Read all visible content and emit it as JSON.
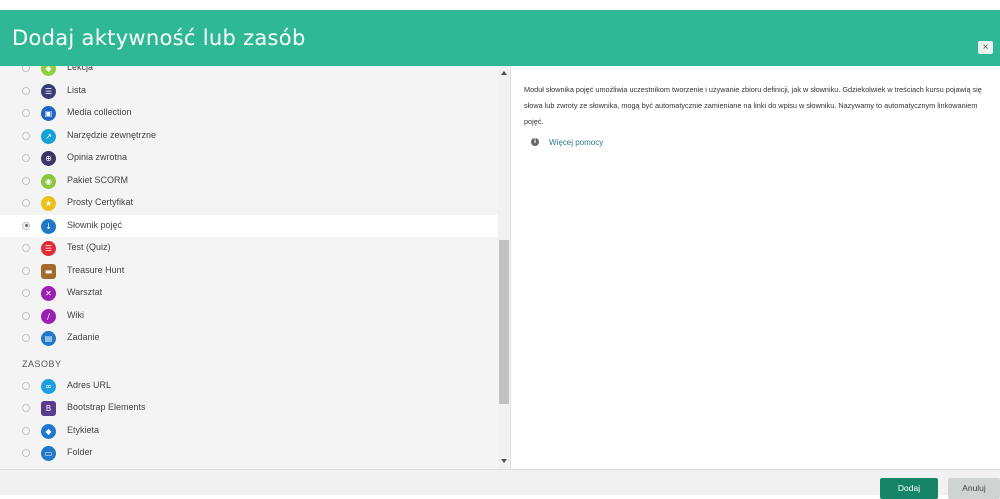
{
  "dialog": {
    "title": "Dodaj aktywność lub zasób",
    "close_label": "×"
  },
  "activities": [
    {
      "label": "Lekcja",
      "icon": "lesson-icon",
      "color": "#8fcf3a",
      "glyph": "◆"
    },
    {
      "label": "Lista",
      "icon": "checklist-icon",
      "color": "#3b3b7a",
      "glyph": "☰"
    },
    {
      "label": "Media collection",
      "icon": "media-collection-icon",
      "color": "#1f64c7",
      "glyph": "▣"
    },
    {
      "label": "Narzędzie zewnętrzne",
      "icon": "external-tool-icon",
      "color": "#15a0d6",
      "glyph": "↗"
    },
    {
      "label": "Opinia zwrotna",
      "icon": "feedback-icon",
      "color": "#3c3566",
      "glyph": "⊕"
    },
    {
      "label": "Pakiet SCORM",
      "icon": "scorm-package-icon",
      "color": "#8cc63e",
      "glyph": "◉"
    },
    {
      "label": "Prosty Certyfikat",
      "icon": "certificate-icon",
      "color": "#e8c21b",
      "glyph": "★"
    },
    {
      "label": "Słownik pojęć",
      "icon": "glossary-icon",
      "color": "#1f78c9",
      "glyph": "↓"
    },
    {
      "label": "Test (Quiz)",
      "icon": "quiz-icon",
      "color": "#e02b38",
      "glyph": "☰"
    },
    {
      "label": "Treasure Hunt",
      "icon": "treasure-chest-icon",
      "color": "#a46a2b",
      "glyph": "▬"
    },
    {
      "label": "Warsztat",
      "icon": "workshop-icon",
      "color": "#9b1fb3",
      "glyph": "✕"
    },
    {
      "label": "Wiki",
      "icon": "wiki-icon",
      "color": "#9b1fb3",
      "glyph": "∕"
    },
    {
      "label": "Zadanie",
      "icon": "assignment-icon",
      "color": "#1f78c9",
      "glyph": "▤"
    }
  ],
  "resources_heading": "ZASOBY",
  "resources": [
    {
      "label": "Adres URL",
      "icon": "url-link-icon",
      "color": "#1ea0e0",
      "glyph": "∞"
    },
    {
      "label": "Bootstrap Elements",
      "icon": "bootstrap-icon",
      "color": "#5b3b8c",
      "glyph": "B"
    },
    {
      "label": "Etykieta",
      "icon": "label-tag-icon",
      "color": "#1f78c9",
      "glyph": "◆"
    },
    {
      "label": "Folder",
      "icon": "folder-icon",
      "color": "#1f78c9",
      "glyph": "▭"
    }
  ],
  "selected_index": 7,
  "description": "Moduł słownika pojęć umożliwia uczestnikom tworzenie i używanie zbioru definicji, jak w słowniku. Gdziekolwiek w treściach kursu pojawią się słowa lub zwroty ze słownika, mogą być automatycznie zamieniane na linki do wpisu w słowniku. Nazywamy to automatycznym linkowaniem pojęć.",
  "help_link": "Więcej pomocy",
  "buttons": {
    "add": "Dodaj",
    "cancel": "Anuluj"
  }
}
